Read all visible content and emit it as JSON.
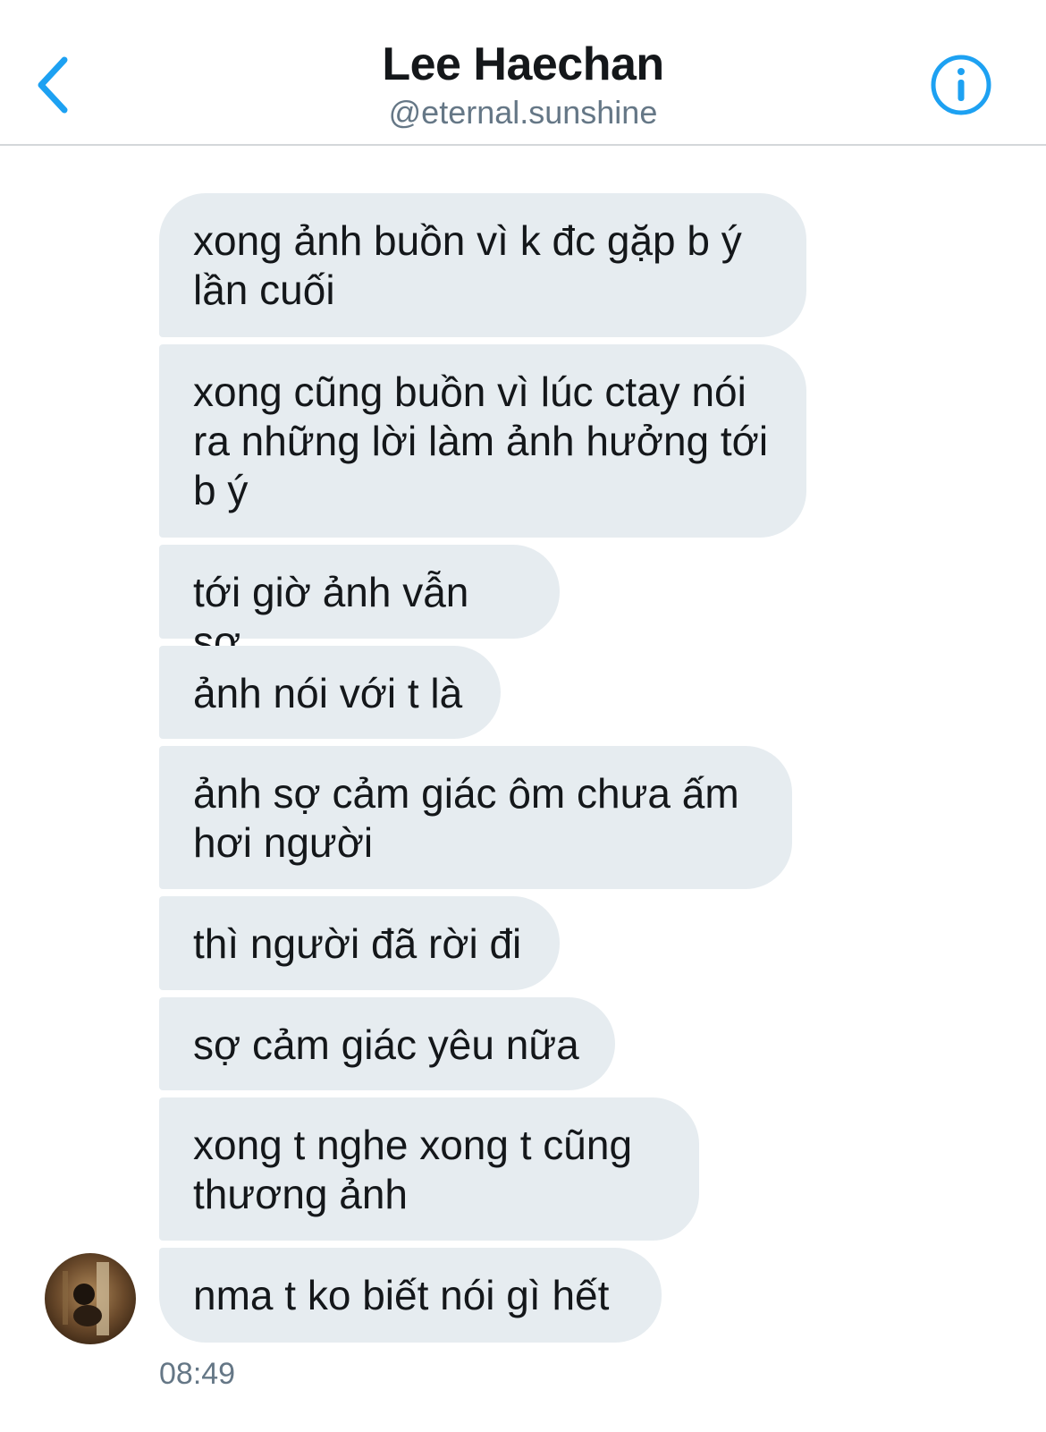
{
  "header": {
    "name": "Lee Haechan",
    "handle": "@eternal.sunshine"
  },
  "messages": [
    {
      "text": "xong ảnh buồn vì k đc gặp b ý\nlần cuối"
    },
    {
      "text": "xong cũng buồn vì lúc ctay nói\nra những lời làm ảnh hưởng tới\nb ý"
    },
    {
      "text": "tới giờ ảnh vẫn sợ"
    },
    {
      "text": "ảnh nói với t là"
    },
    {
      "text": "ảnh sợ cảm giác ôm chưa ấm\nhơi người"
    },
    {
      "text": "thì người đã rời đi"
    },
    {
      "text": "sợ cảm giác yêu nữa"
    },
    {
      "text": "xong t nghe xong t cũng\nthương ảnh"
    },
    {
      "text": "nma t ko biết nói gì hết"
    }
  ],
  "timestamp": "08:49",
  "colors": {
    "accent": "#1da1f2",
    "bubble": "#e6ecf0",
    "text": "#14171a",
    "secondary": "#657786"
  },
  "icons": {
    "back": "chevron-left-icon",
    "info": "info-circle-icon"
  }
}
